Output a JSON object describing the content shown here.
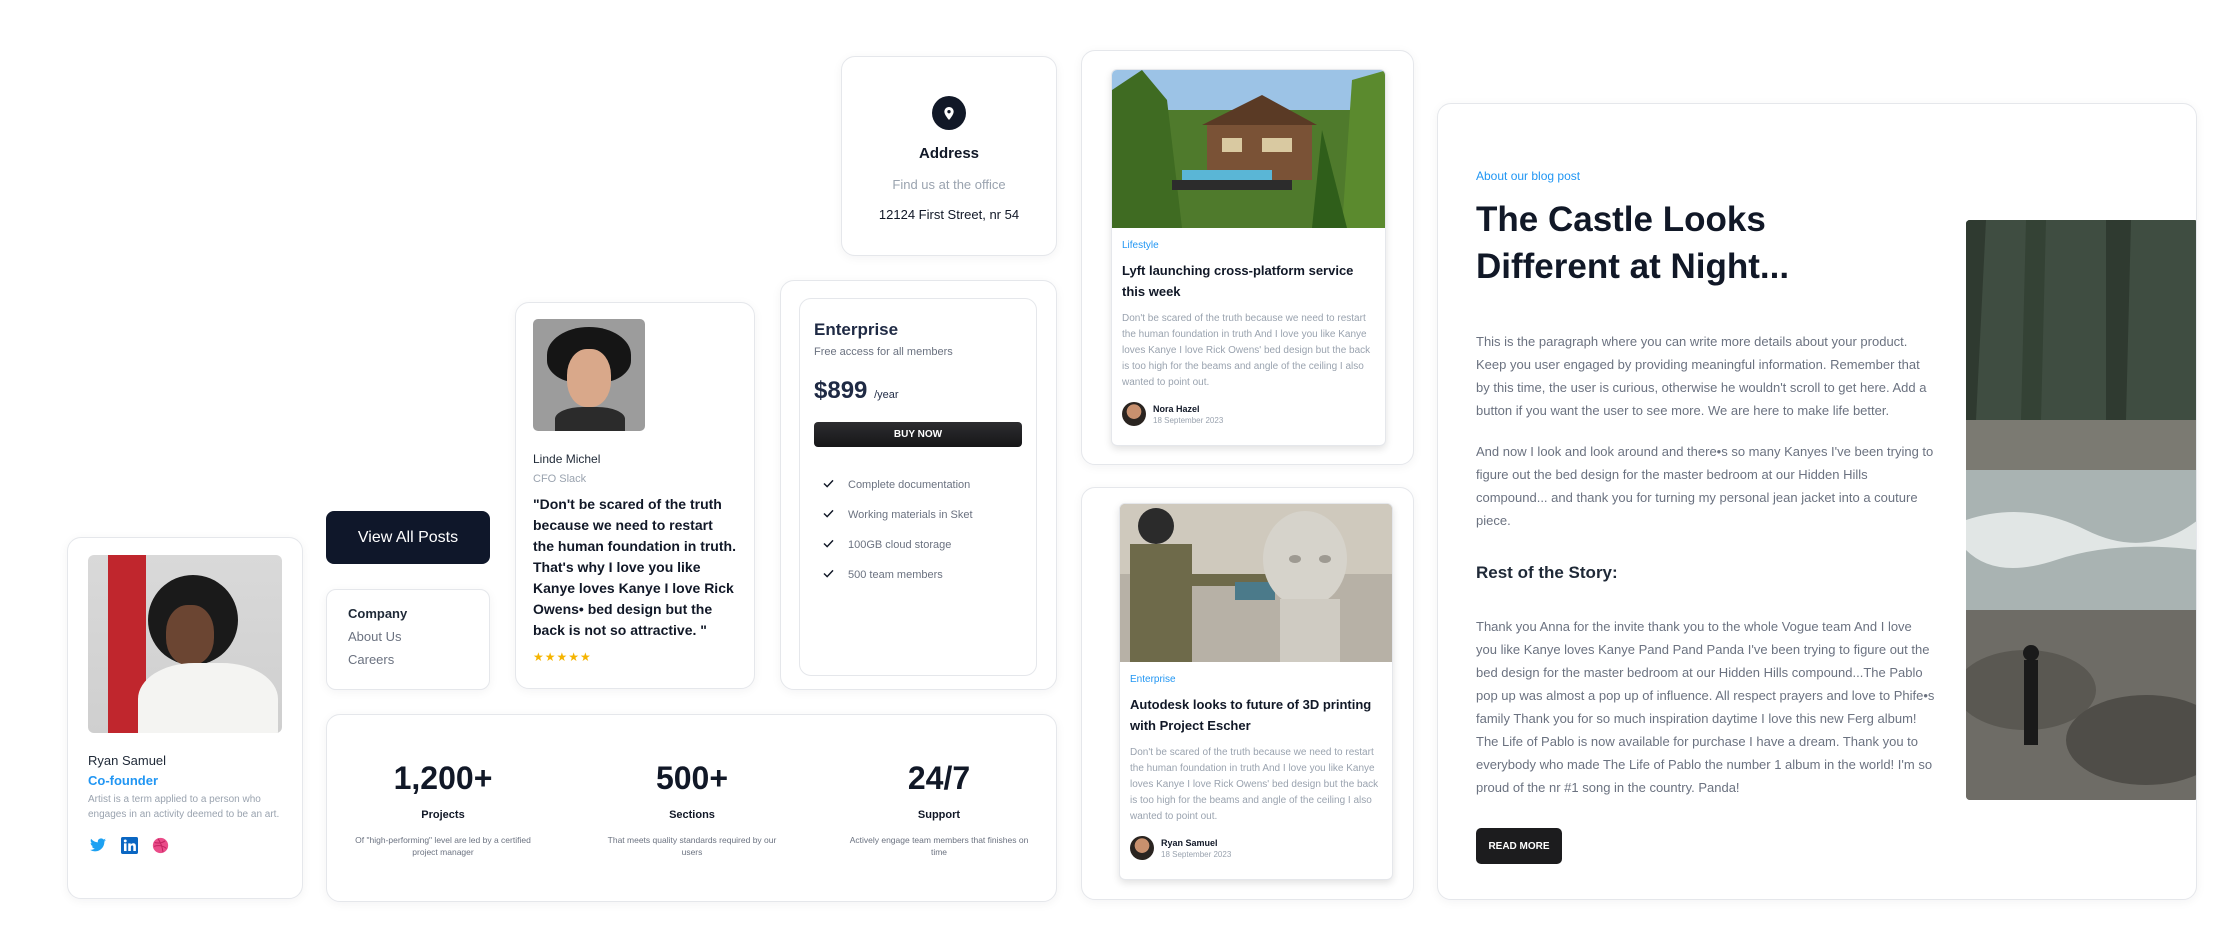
{
  "profile": {
    "name": "Ryan Samuel",
    "role": "Co-founder",
    "bio": "Artist is a term applied to a person who engages in an activity deemed to be an art.",
    "socials": [
      "twitter-icon",
      "linkedin-icon",
      "dribbble-icon"
    ]
  },
  "posts_button": {
    "label": "View All Posts"
  },
  "company": {
    "heading": "Company",
    "links": [
      "About Us",
      "Careers"
    ]
  },
  "testimonial": {
    "name": "Linde Michel",
    "company": "CFO Slack",
    "quote": "\"Don't be scared of the truth because we need to restart the human foundation in truth. That's why I love you like Kanye loves Kanye I love Rick Owens• bed design but the back is not so attractive. \"",
    "rating_stars": "★★★★★",
    "rating": 5
  },
  "address": {
    "title": "Address",
    "subtitle": "Find us at the office",
    "line": "12124 First Street, nr 54"
  },
  "pricing": {
    "plan": "Enterprise",
    "description": "Free access for all members",
    "price": "$899",
    "period": "/year",
    "button": "BUY NOW",
    "features": [
      "Complete documentation",
      "Working materials in Sket",
      "100GB cloud storage",
      "500 team members"
    ]
  },
  "stats": [
    {
      "value": "1,200+",
      "label": "Projects",
      "description": "Of \"high-performing\" level are led by a certified project manager"
    },
    {
      "value": "500+",
      "label": "Sections",
      "description": "That meets quality standards required by our users"
    },
    {
      "value": "24/7",
      "label": "Support",
      "description": "Actively engage team members that finishes on time"
    }
  ],
  "blog_cards": [
    {
      "category": "Lifestyle",
      "title": "Lyft launching cross-platform service this week",
      "excerpt": "Don't be scared of the truth because we need to restart the human foundation in truth And I love you like Kanye loves Kanye I love Rick Owens' bed design but the back is too high for the beams and angle of the ceiling I also wanted to point out.",
      "author": "Nora Hazel",
      "date": "18 September 2023"
    },
    {
      "category": "Enterprise",
      "title": "Autodesk looks to future of 3D printing with Project Escher",
      "excerpt": "Don't be scared of the truth because we need to restart the human foundation in truth And I love you like Kanye loves Kanye I love Rick Owens' bed design but the back is too high for the beams and angle of the ceiling I also wanted to point out.",
      "author": "Ryan Samuel",
      "date": "18 September 2023"
    }
  ],
  "article": {
    "kicker": "About our blog post",
    "title": "The Castle Looks Different at Night...",
    "paragraphs": [
      "This is the paragraph where you can write more details about your product. Keep you user engaged by providing meaningful information. Remember that by this time, the user is curious, otherwise he wouldn't scroll to get here. Add a button if you want the user to see more. We are here to make life better.",
      "And now I look and look around and there•s so many Kanyes I've been trying to figure out the bed design for the master bedroom at our Hidden Hills compound... and thank you for turning my personal jean jacket into a couture piece."
    ],
    "subheading": "Rest of the Story:",
    "story": "Thank you Anna for the invite thank you to the whole Vogue team And I love you like Kanye loves Kanye Pand Pand Panda I've been trying to figure out the bed design for the master bedroom at our Hidden Hills compound...The Pablo pop up was almost a pop up of influence. All respect prayers and love to Phife•s family Thank you for so much inspiration daytime I love this new Ferg album! The Life of Pablo is now available for purchase I have a dream. Thank you to everybody who made The Life of Pablo the number 1 album in the world! I'm so proud of the nr #1 song in the country. Panda!",
    "button": "READ MORE"
  }
}
